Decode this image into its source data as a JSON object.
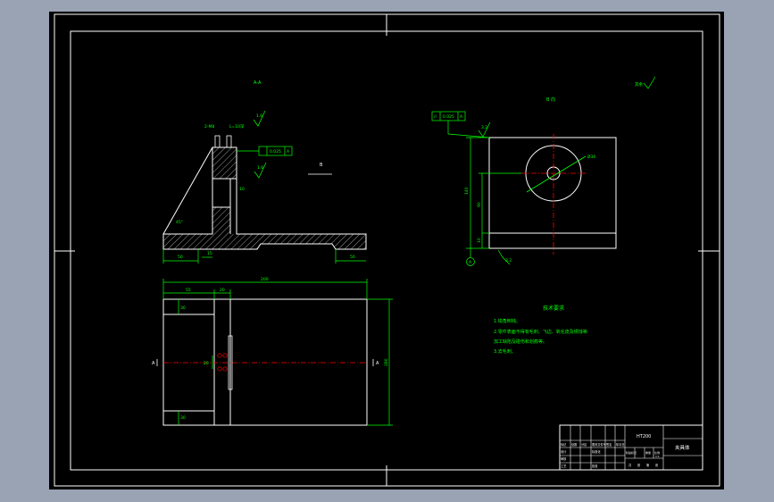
{
  "app": {
    "background": "#9aa3b4",
    "sheet_color": "#000000",
    "line_color": "#ffffff",
    "dim_color": "#00ff00",
    "center_color": "#ff0000",
    "title_color": "#ffff00"
  },
  "views": {
    "section_label": "A-A",
    "direction_label": "B 向",
    "view_arrow_label": "B",
    "section_marker_left": "A",
    "section_marker_right": "A"
  },
  "section_view": {
    "thread_label": "2-M8",
    "depth_label": "L=10深",
    "flatness_value": "0.025",
    "flatness_datum": "A",
    "rough_top": "1.6",
    "rough_mid": "1.6",
    "angle_label": "45°",
    "dim_10": "10",
    "dim_left_base": "50",
    "dim_stem": "15",
    "dim_right_base": "50",
    "parallel_value": "0.025",
    "parallel_datum": "A"
  },
  "b_view": {
    "rough_top": "3.2",
    "rough_bottom": "3.2",
    "dim_total_height": "140",
    "dim_hole_height": "90",
    "dim_base": "10",
    "dim_hole": "Ø30",
    "datum_label": "A"
  },
  "plan_view": {
    "dim_total_width": "200",
    "dim_left": "55",
    "dim_stem": "20",
    "dim_top_rail": "30",
    "dim_bottom_rail": "30",
    "dim_holes": "20",
    "dim_right_height": "280"
  },
  "notes": {
    "title": "技术要求",
    "lines": [
      "1.锐角倒钝。",
      "2.零件表面不得有毛刺、飞边、氧化皮及锈蚀等",
      "加工缺陷及碰伤和划痕等。",
      "3.去毛刺。"
    ]
  },
  "overall_roughness": "其余",
  "title_block": {
    "part_name": "夹具体",
    "material": "HT200",
    "row_labels": [
      "标记",
      "处数",
      "分区",
      "更改文件号",
      "签名",
      "年月日"
    ],
    "row2_labels": [
      "设计",
      "标准化"
    ],
    "row3_labels": [
      "审核",
      "工艺",
      "批准"
    ],
    "stage_labels": [
      "阶段标记",
      "重量",
      "比例"
    ],
    "scale": "1:1",
    "sheet_labels": [
      "共",
      "张",
      "第",
      "张"
    ]
  }
}
